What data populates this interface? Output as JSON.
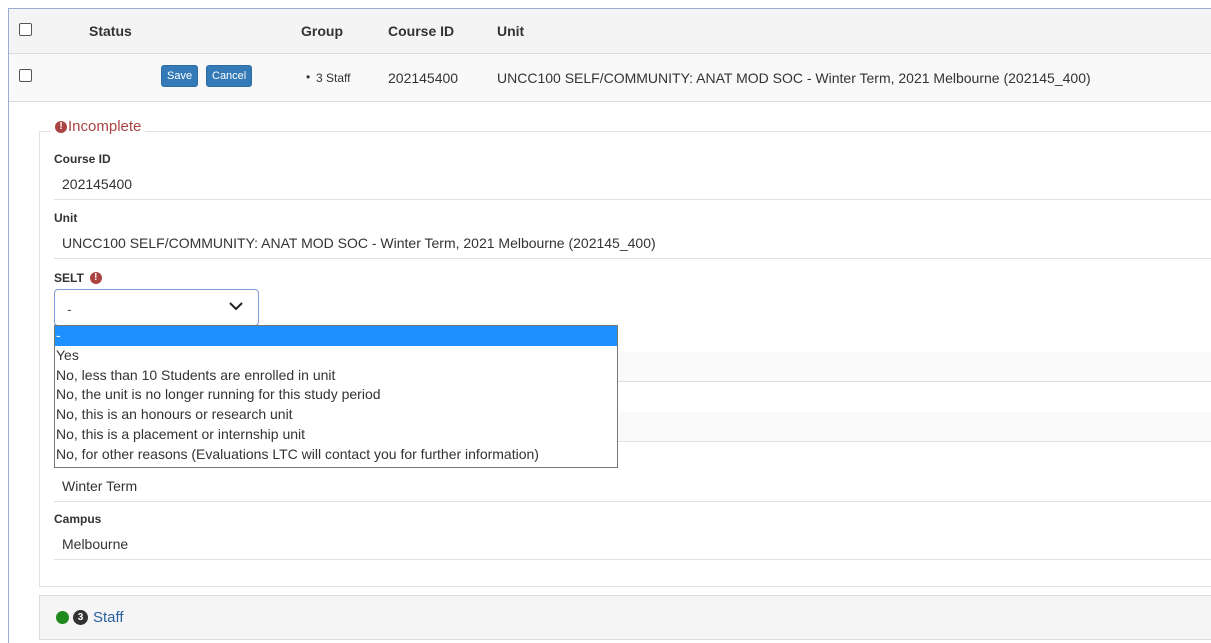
{
  "table": {
    "headers": {
      "status": "Status",
      "group": "Group",
      "course_id": "Course ID",
      "unit": "Unit"
    },
    "row": {
      "save_label": "Save",
      "cancel_label": "Cancel",
      "group": "3 Staff",
      "course_id": "202145400",
      "unit": "UNCC100 SELF/COMMUNITY: ANAT MOD SOC - Winter Term, 2021 Melbourne (202145_400)"
    }
  },
  "form": {
    "legend": "Incomplete",
    "legend_icon": "exclamation-circle-icon",
    "course_id_label": "Course ID",
    "course_id_value": "202145400",
    "unit_label": "Unit",
    "unit_value": "UNCC100 SELF/COMMUNITY: ANAT MOD SOC - Winter Term, 2021 Melbourne (202145_400)",
    "selt_label": "SELT",
    "selt_selected": "-",
    "selt_options": [
      "-",
      "Yes",
      "No, less than 10 Students are enrolled in unit",
      "No, the unit is no longer running for this study period",
      "No, this is an honours or research unit",
      "No, this is a placement or internship unit",
      "No, for other reasons (Evaluations LTC will contact you for further information)"
    ],
    "term_value": "Winter Term",
    "campus_label": "Campus",
    "campus_value": "Melbourne"
  },
  "staff_section": {
    "count": "3",
    "label": "Staff"
  },
  "colors": {
    "primary": "#337ab7",
    "danger": "#a94442",
    "success": "#1e8a1e",
    "highlight": "#1e90ff"
  }
}
